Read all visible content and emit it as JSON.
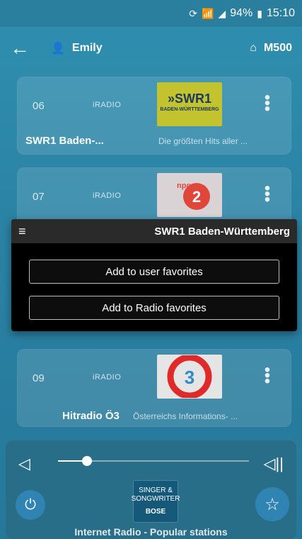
{
  "status": {
    "icons": [
      "sync-icon",
      "wifi-icon",
      "signal-icon",
      "battery-icon"
    ],
    "battery": "94%",
    "time": "15:10"
  },
  "appbar": {
    "user": "Emily",
    "device": "M500"
  },
  "cards": [
    {
      "number": "06",
      "source": "iRADIO",
      "name": "SWR1 Baden-...",
      "description": "Die größten Hits aller ...",
      "logo": "»SWR1\nBADEN-WÜRTTEMBERG"
    },
    {
      "number": "07",
      "source": "iRADIO",
      "name": "",
      "description": "",
      "logo": "npo radio 2"
    },
    {
      "number": "09",
      "source": "iRADIO",
      "name": "Hitradio Ö3",
      "description": "Österreichs Informations- ...",
      "logo": "Ö3"
    }
  ],
  "dialog": {
    "title": "SWR1 Baden-Württemberg",
    "buttons": [
      "Add to user favorites",
      "Add to Radio favorites"
    ]
  },
  "player": {
    "volume_level": 0.15,
    "now_playing_logo": "SINGER & SONGWRITER",
    "now_playing_brand": "BOSE",
    "label": "Internet Radio - Popular stations"
  },
  "colors": {
    "accent": "#2f84b4",
    "background": "#2b83a4"
  }
}
